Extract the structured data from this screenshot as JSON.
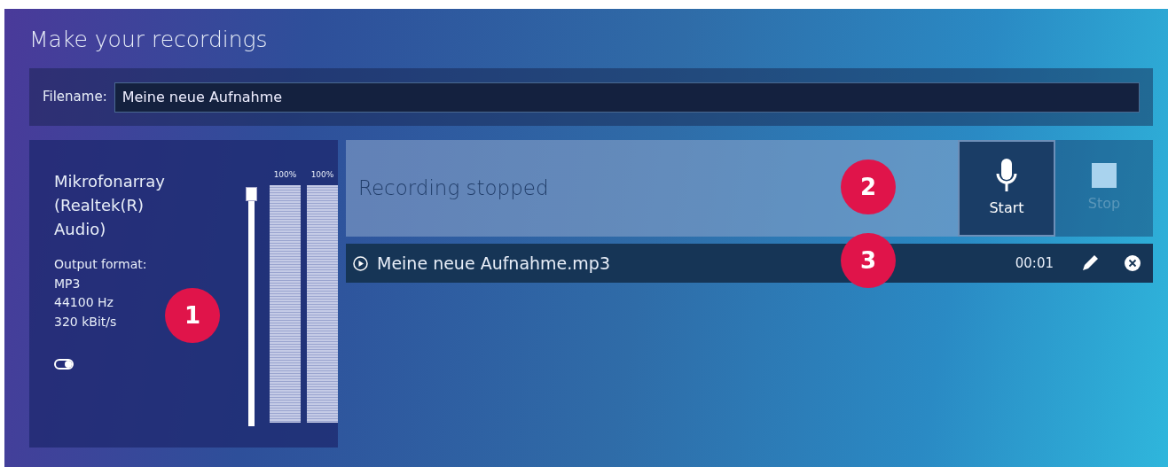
{
  "window": {
    "title": "Make your recordings"
  },
  "filename": {
    "label": "Filename:",
    "value": "Meine neue Aufnahme"
  },
  "device": {
    "name": "Mikrofonarray (Realtek(R) Audio)",
    "format_lines": [
      "Output format:",
      "MP3",
      "44100 Hz",
      "320 kBit/s"
    ],
    "toggle_on": true,
    "volume": {
      "level": 1
    },
    "meters": [
      {
        "reading": "100%",
        "level": 1
      },
      {
        "reading": "100%",
        "level": 1
      }
    ]
  },
  "status": {
    "text": "Recording stopped"
  },
  "buttons": [
    {
      "kind": "start",
      "label": "Start",
      "disabled": false
    },
    {
      "kind": "stop",
      "label": "Stop",
      "disabled": true
    }
  ],
  "recordings": [
    {
      "name": "Meine neue Aufnahme.mp3",
      "duration": "00:01"
    }
  ],
  "callouts": [
    {
      "number": "1"
    },
    {
      "number": "2"
    },
    {
      "number": "3"
    }
  ]
}
